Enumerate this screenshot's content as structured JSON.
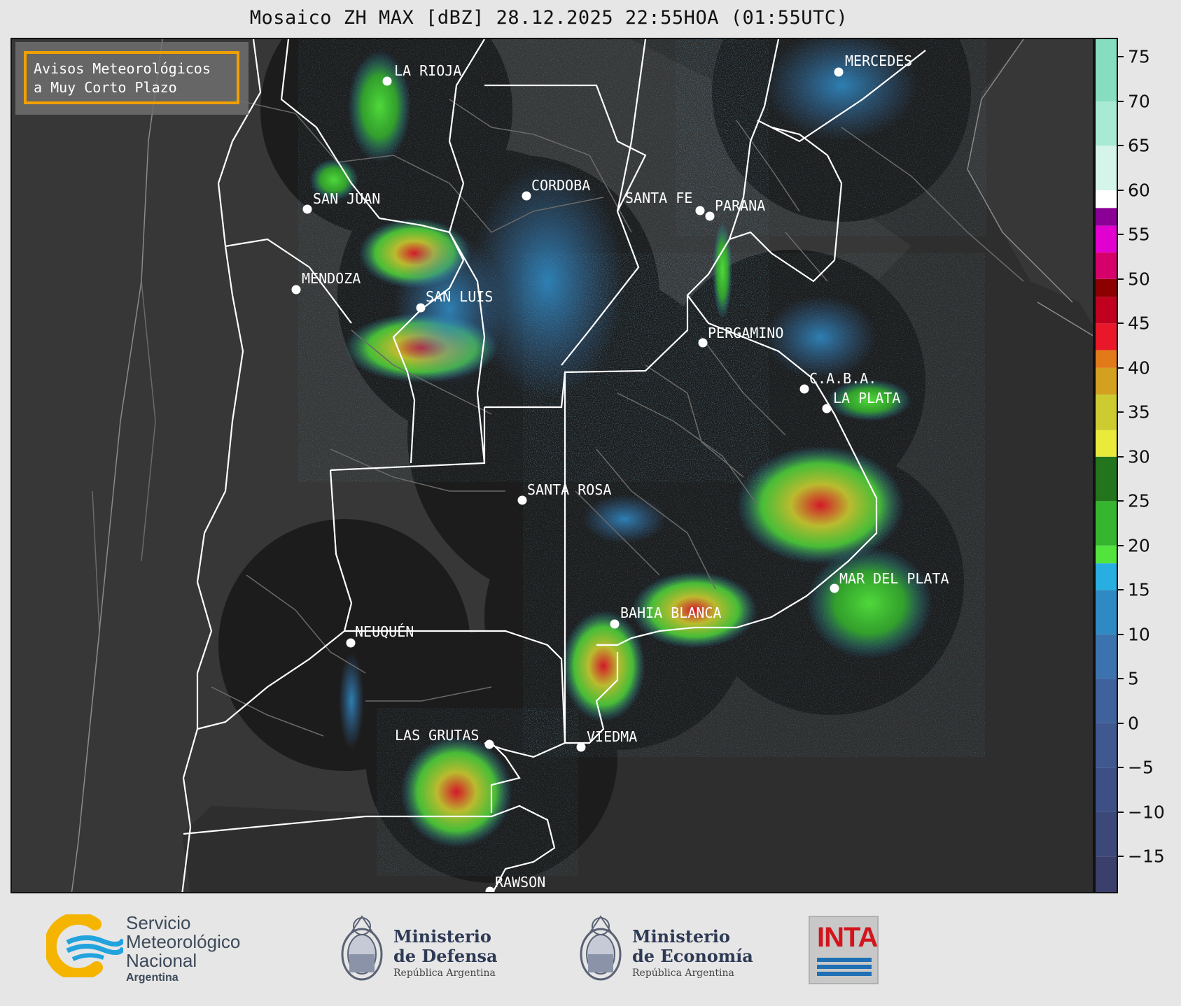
{
  "title": "Mosaico ZH MAX [dBZ] 28.12.2025 22:55HOA (01:55UTC)",
  "badge": {
    "line1": "Avisos Meteorológicos",
    "line2": "a Muy Corto Plazo",
    "border_color": "#f0a000"
  },
  "cities": [
    {
      "name": "LA RIOJA"
    },
    {
      "name": "SAN JUAN"
    },
    {
      "name": "CORDOBA"
    },
    {
      "name": "MENDOZA"
    },
    {
      "name": "SAN LUIS"
    },
    {
      "name": "SANTA FE"
    },
    {
      "name": "PARANA"
    },
    {
      "name": "MERCEDES"
    },
    {
      "name": "PERGAMINO"
    },
    {
      "name": "C.A.B.A."
    },
    {
      "name": "LA PLATA"
    },
    {
      "name": "SANTA ROSA"
    },
    {
      "name": "MAR DEL PLATA"
    },
    {
      "name": "BAHIA BLANCA"
    },
    {
      "name": "NEUQUÉN"
    },
    {
      "name": "LAS GRUTAS"
    },
    {
      "name": "VIEDMA"
    },
    {
      "name": "RAWSON"
    }
  ],
  "colorbar": {
    "unit": "dBZ",
    "range": [
      -19,
      77
    ],
    "ticks": [
      "75",
      "70",
      "65",
      "60",
      "55",
      "50",
      "45",
      "40",
      "35",
      "30",
      "25",
      "20",
      "15",
      "10",
      "5",
      "0",
      "−5",
      "−10",
      "−15"
    ],
    "tick_values": [
      75,
      70,
      65,
      60,
      55,
      50,
      45,
      40,
      35,
      30,
      25,
      20,
      15,
      10,
      5,
      0,
      -5,
      -10,
      -15
    ],
    "segments": [
      {
        "from": -19,
        "to": -15,
        "color": "#3a3f6b"
      },
      {
        "from": -15,
        "to": -10,
        "color": "#3c4878"
      },
      {
        "from": -10,
        "to": -5,
        "color": "#3d4f84"
      },
      {
        "from": -5,
        "to": 0,
        "color": "#3f5890"
      },
      {
        "from": 0,
        "to": 5,
        "color": "#3f619c"
      },
      {
        "from": 5,
        "to": 10,
        "color": "#3c72ae"
      },
      {
        "from": 10,
        "to": 15,
        "color": "#2f8ac3"
      },
      {
        "from": 15,
        "to": 18,
        "color": "#28aee0"
      },
      {
        "from": 18,
        "to": 20,
        "color": "#52e33c"
      },
      {
        "from": 20,
        "to": 25,
        "color": "#36b52e"
      },
      {
        "from": 25,
        "to": 30,
        "color": "#22741d"
      },
      {
        "from": 30,
        "to": 33,
        "color": "#eaea3a"
      },
      {
        "from": 33,
        "to": 37,
        "color": "#cccc30"
      },
      {
        "from": 37,
        "to": 40,
        "color": "#d3a020"
      },
      {
        "from": 40,
        "to": 42,
        "color": "#e27a1a"
      },
      {
        "from": 42,
        "to": 45,
        "color": "#e8182a"
      },
      {
        "from": 45,
        "to": 48,
        "color": "#c0001e"
      },
      {
        "from": 48,
        "to": 50,
        "color": "#8c0000"
      },
      {
        "from": 50,
        "to": 53,
        "color": "#d6006a"
      },
      {
        "from": 53,
        "to": 56,
        "color": "#e100d0"
      },
      {
        "from": 56,
        "to": 58,
        "color": "#8a0096"
      },
      {
        "from": 58,
        "to": 60,
        "color": "#ffffff"
      },
      {
        "from": 60,
        "to": 65,
        "color": "#d6f5ea"
      },
      {
        "from": 65,
        "to": 70,
        "color": "#a8ead3"
      },
      {
        "from": 70,
        "to": 77,
        "color": "#86ddbf"
      }
    ]
  },
  "logos": {
    "smn": {
      "line1": "Servicio",
      "line2": "Meteorológico",
      "line3": "Nacional",
      "country": "Argentina"
    },
    "defensa": {
      "line1": "Ministerio",
      "line2": "de Defensa",
      "sub": "República Argentina"
    },
    "economia": {
      "line1": "Ministerio",
      "line2": "de Economía",
      "sub": "República Argentina"
    },
    "inta": {
      "text": "INTA"
    }
  }
}
